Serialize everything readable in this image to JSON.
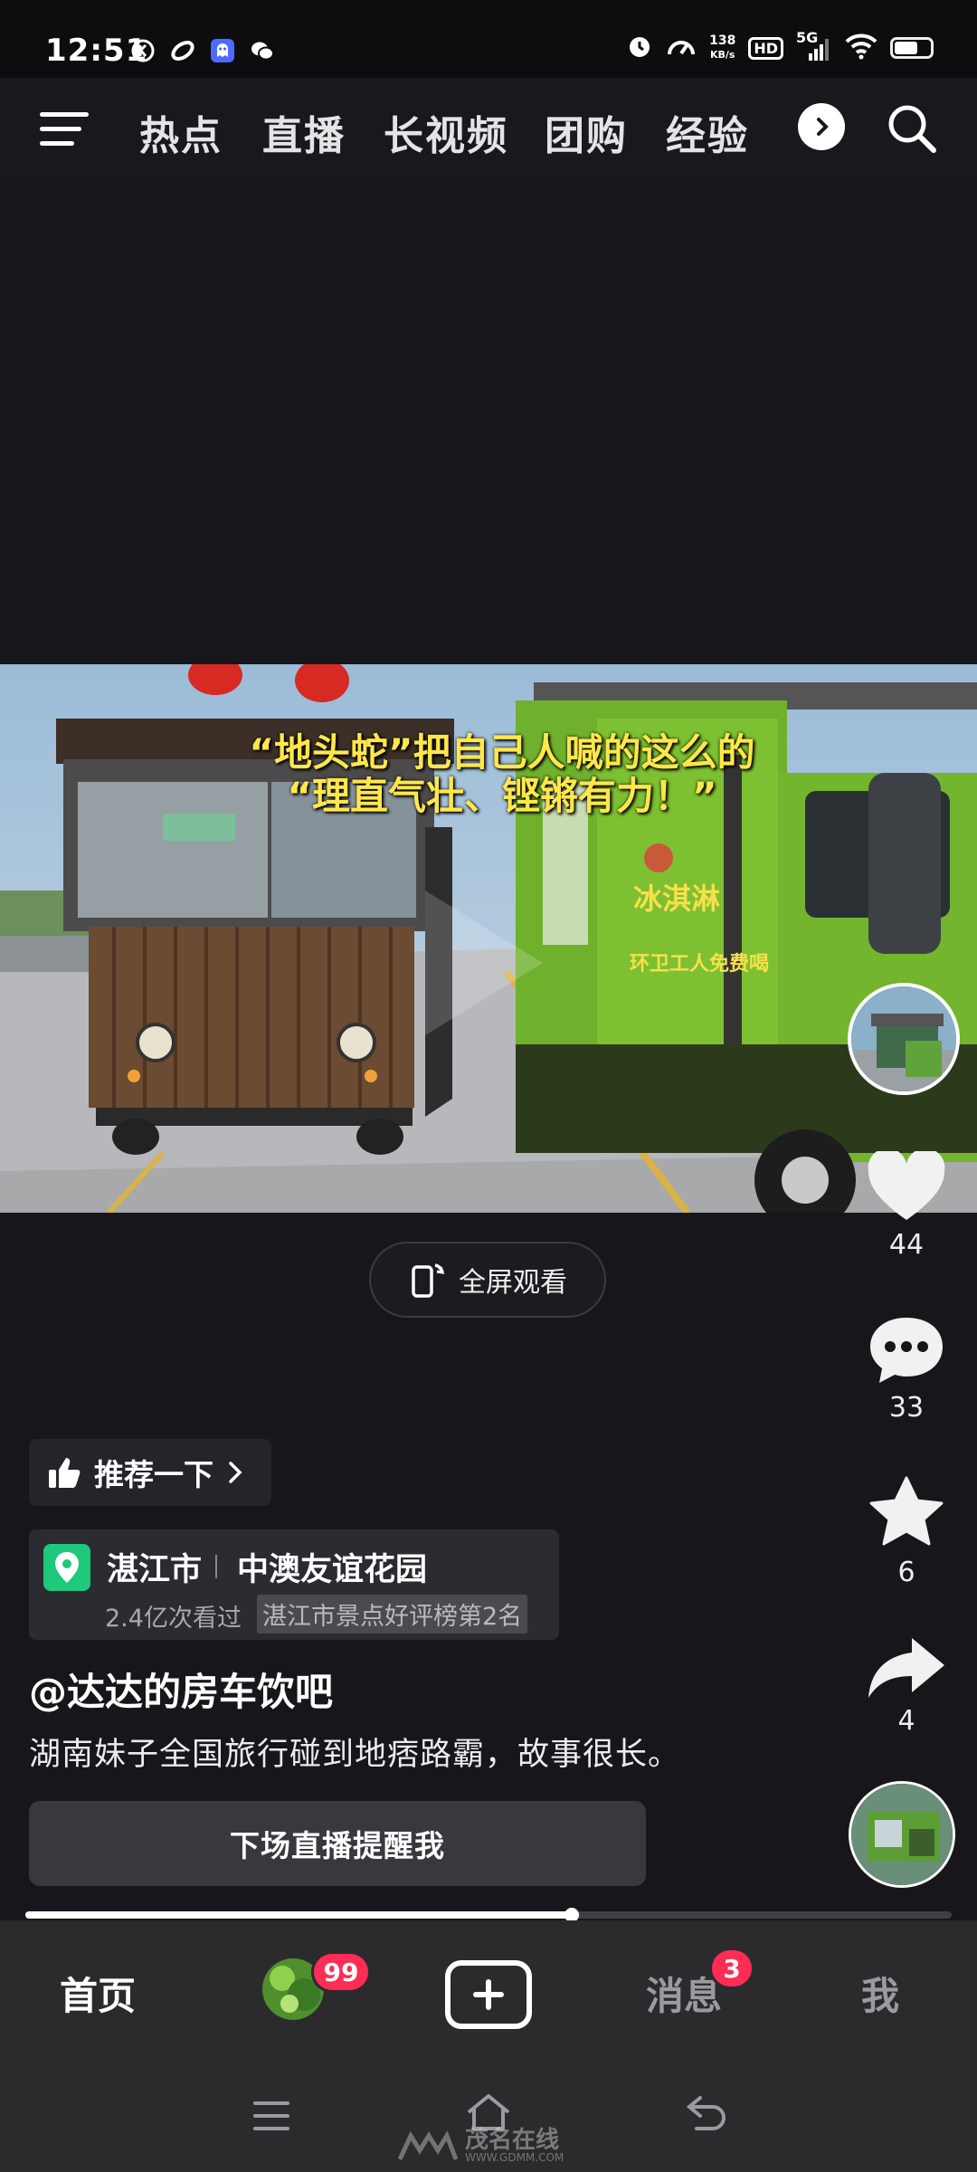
{
  "status_bar": {
    "time": "12:51",
    "net_speed_value": "138",
    "net_speed_unit": "KB/s",
    "hd_label": "HD",
    "network_type": "5G",
    "icons": [
      "k-circle-icon",
      "swirl-icon",
      "ghost-app-icon",
      "wechat-icon",
      "alarm-icon",
      "speedometer-icon",
      "signal-icon",
      "wifi-icon",
      "battery-icon"
    ]
  },
  "top_nav": {
    "tabs": [
      {
        "label": "热点"
      },
      {
        "label": "直播"
      },
      {
        "label": "长视频"
      },
      {
        "label": "团购"
      },
      {
        "label": "经验"
      }
    ]
  },
  "video": {
    "caption_line1": "“地头蛇”把自己人喊的这么的",
    "caption_line2": "“理直气壮、铿锵有力！”",
    "truck_sign": "冰淇淋",
    "truck_sign_sub": "环卫工人免费喝",
    "fullscreen_label": "全屏观看"
  },
  "actions": {
    "likes": "44",
    "comments": "33",
    "favorites": "6",
    "shares": "4"
  },
  "info": {
    "recommend_label": "推荐一下",
    "location_city": "湛江市",
    "location_place": "中澳友谊花园",
    "location_views": "2.4亿次看过",
    "location_rank": "湛江市景点好评榜第2名",
    "author": "@达达的房车饮吧",
    "description": "湖南妹子全国旅行碰到地痞路霸，故事很长。",
    "live_remind_label": "下场直播提醒我"
  },
  "progress": {
    "played_fraction": 0.59
  },
  "bottom_nav": {
    "home": "首页",
    "friends_badge": "99",
    "messages": "消息",
    "messages_badge": "3",
    "me": "我"
  },
  "watermark": {
    "text": "茂名在线",
    "sub": "WWW.GDMM.COM"
  },
  "colors": {
    "background": "#16161b",
    "accent_badge": "#ff2c55",
    "caption_yellow": "#ffe74a",
    "location_green": "#1fc87a"
  }
}
